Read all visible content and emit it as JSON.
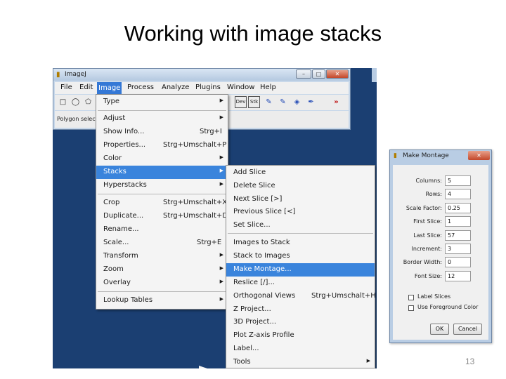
{
  "slide": {
    "title": "Working with image stacks",
    "page_number": "13"
  },
  "imagej": {
    "title": "ImageJ",
    "window_buttons": {
      "minimize": "–",
      "maximize": "□",
      "close": "✕"
    },
    "menubar": [
      "File",
      "Edit",
      "Image",
      "Process",
      "Analyze",
      "Plugins",
      "Window",
      "Help"
    ],
    "active_menu": "Image",
    "toolbar": {
      "rect_tool": "□",
      "oval_tool": "◯",
      "polygon_tool": "⬠",
      "dev_tool": "Dev",
      "stk_tool": "Stk",
      "pencil_tool": "✎",
      "brush_tool": "✎",
      "fill_tool": "◈",
      "dropper_tool": "✒",
      "more_tool": "»"
    },
    "status": "Polygon selections"
  },
  "image_menu": [
    {
      "label": "Type",
      "shortcut": "",
      "submenu": true
    },
    {
      "label": "Adjust",
      "shortcut": "",
      "submenu": true
    },
    {
      "label": "Show Info...",
      "shortcut": "Strg+I",
      "submenu": false
    },
    {
      "label": "Properties...",
      "shortcut": "Strg+Umschalt+P",
      "submenu": false
    },
    {
      "label": "Color",
      "shortcut": "",
      "submenu": true
    },
    {
      "label": "Stacks",
      "shortcut": "",
      "submenu": true,
      "highlighted": true
    },
    {
      "label": "Hyperstacks",
      "shortcut": "",
      "submenu": true
    },
    {
      "label": "Crop",
      "shortcut": "Strg+Umschalt+X",
      "submenu": false
    },
    {
      "label": "Duplicate...",
      "shortcut": "Strg+Umschalt+D",
      "submenu": false
    },
    {
      "label": "Rename...",
      "shortcut": "",
      "submenu": false
    },
    {
      "label": "Scale...",
      "shortcut": "Strg+E",
      "submenu": false
    },
    {
      "label": "Transform",
      "shortcut": "",
      "submenu": true
    },
    {
      "label": "Zoom",
      "shortcut": "",
      "submenu": true
    },
    {
      "label": "Overlay",
      "shortcut": "",
      "submenu": true
    },
    {
      "label": "Lookup Tables",
      "shortcut": "",
      "submenu": true
    }
  ],
  "stacks_menu": [
    {
      "label": "Add Slice",
      "shortcut": ""
    },
    {
      "label": "Delete Slice",
      "shortcut": ""
    },
    {
      "label": "Next Slice [>]",
      "shortcut": ""
    },
    {
      "label": "Previous Slice [<]",
      "shortcut": ""
    },
    {
      "label": "Set Slice...",
      "shortcut": ""
    },
    {
      "label": "Images to Stack",
      "shortcut": ""
    },
    {
      "label": "Stack to Images",
      "shortcut": ""
    },
    {
      "label": "Make Montage...",
      "shortcut": "",
      "highlighted": true
    },
    {
      "label": "Reslice [/]...",
      "shortcut": ""
    },
    {
      "label": "Orthogonal Views",
      "shortcut": "Strg+Umschalt+H"
    },
    {
      "label": "Z Project...",
      "shortcut": ""
    },
    {
      "label": "3D Project...",
      "shortcut": ""
    },
    {
      "label": "Plot Z-axis Profile",
      "shortcut": ""
    },
    {
      "label": "Label...",
      "shortcut": ""
    },
    {
      "label": "Tools",
      "shortcut": "",
      "submenu": true
    }
  ],
  "montage_dialog": {
    "title": "Make Montage",
    "close": "✕",
    "fields": [
      {
        "label": "Columns:",
        "value": "5"
      },
      {
        "label": "Rows:",
        "value": "4"
      },
      {
        "label": "Scale Factor:",
        "value": "0.25"
      },
      {
        "label": "First Slice:",
        "value": "1"
      },
      {
        "label": "Last Slice:",
        "value": "57"
      },
      {
        "label": "Increment:",
        "value": "3"
      },
      {
        "label": "Border Width:",
        "value": "0"
      },
      {
        "label": "Font Size:",
        "value": "12"
      }
    ],
    "checkboxes": [
      {
        "label": "Label Slices",
        "checked": false
      },
      {
        "label": "Use Foreground Color",
        "checked": false
      }
    ],
    "ok_label": "OK",
    "cancel_label": "Cancel"
  },
  "colors": {
    "desktop": "#1b3f72",
    "highlight": "#3a84dc",
    "dialog_frame": "#b9cde4"
  }
}
